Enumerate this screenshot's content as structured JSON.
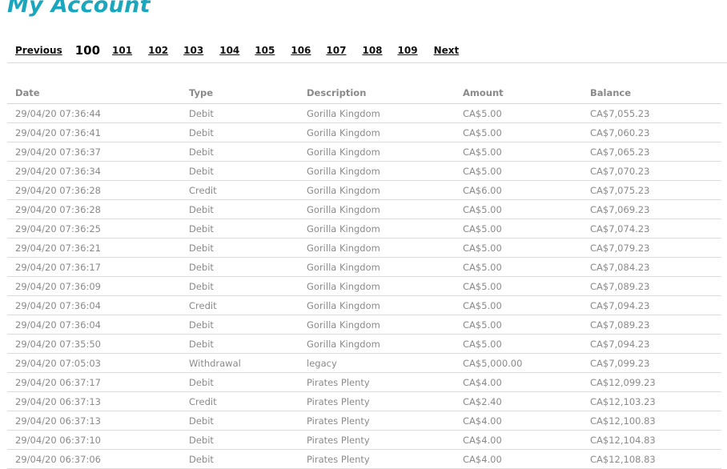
{
  "page": {
    "title": "My Account"
  },
  "pagination": {
    "previous": "Previous",
    "current": "100",
    "pages": [
      "101",
      "102",
      "103",
      "104",
      "105",
      "106",
      "107",
      "108",
      "109"
    ],
    "next": "Next"
  },
  "table": {
    "headers": [
      "Date",
      "Type",
      "Description",
      "Amount",
      "Balance"
    ],
    "rows": [
      [
        "29/04/20 07:36:44",
        "Debit",
        "Gorilla Kingdom",
        "CA$5.00",
        "CA$7,055.23"
      ],
      [
        "29/04/20 07:36:41",
        "Debit",
        "Gorilla Kingdom",
        "CA$5.00",
        "CA$7,060.23"
      ],
      [
        "29/04/20 07:36:37",
        "Debit",
        "Gorilla Kingdom",
        "CA$5.00",
        "CA$7,065.23"
      ],
      [
        "29/04/20 07:36:34",
        "Debit",
        "Gorilla Kingdom",
        "CA$5.00",
        "CA$7,070.23"
      ],
      [
        "29/04/20 07:36:28",
        "Credit",
        "Gorilla Kingdom",
        "CA$6.00",
        "CA$7,075.23"
      ],
      [
        "29/04/20 07:36:28",
        "Debit",
        "Gorilla Kingdom",
        "CA$5.00",
        "CA$7,069.23"
      ],
      [
        "29/04/20 07:36:25",
        "Debit",
        "Gorilla Kingdom",
        "CA$5.00",
        "CA$7,074.23"
      ],
      [
        "29/04/20 07:36:21",
        "Debit",
        "Gorilla Kingdom",
        "CA$5.00",
        "CA$7,079.23"
      ],
      [
        "29/04/20 07:36:17",
        "Debit",
        "Gorilla Kingdom",
        "CA$5.00",
        "CA$7,084.23"
      ],
      [
        "29/04/20 07:36:09",
        "Debit",
        "Gorilla Kingdom",
        "CA$5.00",
        "CA$7,089.23"
      ],
      [
        "29/04/20 07:36:04",
        "Credit",
        "Gorilla Kingdom",
        "CA$5.00",
        "CA$7,094.23"
      ],
      [
        "29/04/20 07:36:04",
        "Debit",
        "Gorilla Kingdom",
        "CA$5.00",
        "CA$7,089.23"
      ],
      [
        "29/04/20 07:35:50",
        "Debit",
        "Gorilla Kingdom",
        "CA$5.00",
        "CA$7,094.23"
      ],
      [
        "29/04/20 07:05:03",
        "Withdrawal",
        "legacy",
        "CA$5,000.00",
        "CA$7,099.23"
      ],
      [
        "29/04/20 06:37:17",
        "Debit",
        "Pirates Plenty",
        "CA$4.00",
        "CA$12,099.23"
      ],
      [
        "29/04/20 06:37:13",
        "Credit",
        "Pirates Plenty",
        "CA$2.40",
        "CA$12,103.23"
      ],
      [
        "29/04/20 06:37:13",
        "Debit",
        "Pirates Plenty",
        "CA$4.00",
        "CA$12,100.83"
      ],
      [
        "29/04/20 06:37:10",
        "Debit",
        "Pirates Plenty",
        "CA$4.00",
        "CA$12,104.83"
      ],
      [
        "29/04/20 06:37:06",
        "Debit",
        "Pirates Plenty",
        "CA$4.00",
        "CA$12,108.83"
      ]
    ]
  }
}
